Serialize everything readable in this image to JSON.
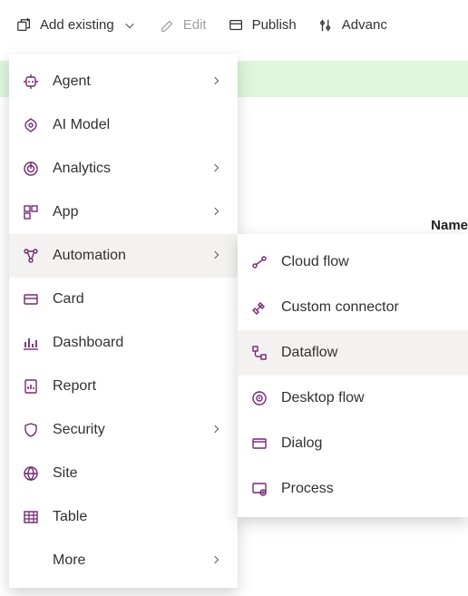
{
  "colors": {
    "accent": "#742774",
    "text": "#323130",
    "muted": "#a19f9d",
    "banner": "#dff6dd",
    "hover": "#f3f2f1"
  },
  "toolbar": {
    "add_existing_label": "Add existing",
    "edit_label": "Edit",
    "publish_label": "Publish",
    "advanced_label": "Advanc"
  },
  "table_header": {
    "name": "Name"
  },
  "menu": {
    "items": [
      {
        "label": "Agent",
        "icon": "agent-icon",
        "has_submenu": true
      },
      {
        "label": "AI Model",
        "icon": "ai-model-icon",
        "has_submenu": false
      },
      {
        "label": "Analytics",
        "icon": "analytics-icon",
        "has_submenu": true
      },
      {
        "label": "App",
        "icon": "app-icon",
        "has_submenu": true
      },
      {
        "label": "Automation",
        "icon": "automation-icon",
        "has_submenu": true,
        "hovered": true
      },
      {
        "label": "Card",
        "icon": "card-icon",
        "has_submenu": false
      },
      {
        "label": "Dashboard",
        "icon": "dashboard-icon",
        "has_submenu": false
      },
      {
        "label": "Report",
        "icon": "report-icon",
        "has_submenu": false
      },
      {
        "label": "Security",
        "icon": "security-icon",
        "has_submenu": true
      },
      {
        "label": "Site",
        "icon": "site-icon",
        "has_submenu": false
      },
      {
        "label": "Table",
        "icon": "table-icon",
        "has_submenu": false
      },
      {
        "label": "More",
        "icon": "",
        "has_submenu": true,
        "indent": true
      }
    ]
  },
  "submenu": {
    "items": [
      {
        "label": "Cloud flow",
        "icon": "cloud-flow-icon"
      },
      {
        "label": "Custom connector",
        "icon": "connector-icon"
      },
      {
        "label": "Dataflow",
        "icon": "dataflow-icon",
        "hovered": true
      },
      {
        "label": "Desktop flow",
        "icon": "desktop-flow-icon"
      },
      {
        "label": "Dialog",
        "icon": "dialog-icon"
      },
      {
        "label": "Process",
        "icon": "process-icon"
      }
    ]
  }
}
